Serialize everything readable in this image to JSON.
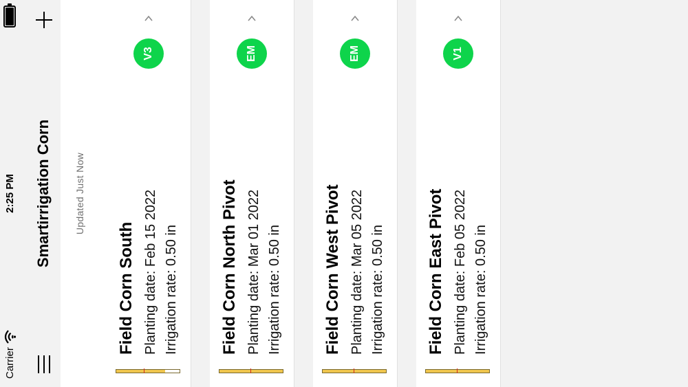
{
  "status_bar": {
    "carrier": "Carrier",
    "time": "2:25 PM"
  },
  "nav": {
    "title": "Smartirrigation Corn"
  },
  "updated_label": "Updated Just Now",
  "fields": [
    {
      "name": "Field Corn South",
      "planting": "Planting date: Feb 15 2022",
      "irrigation": "Irrigation rate: 0.50 in",
      "stage": "V3",
      "progress": 0.77,
      "marker": 0.55
    },
    {
      "name": "Field Corn North Pivot",
      "planting": "Planting date: Mar 01 2022",
      "irrigation": "Irrigation rate: 0.50 in",
      "stage": "EM",
      "progress": 1.0,
      "marker": 0.5
    },
    {
      "name": "Field Corn West Pivot",
      "planting": "Planting date: Mar 05 2022",
      "irrigation": "Irrigation rate: 0.50 in",
      "stage": "EM",
      "progress": 1.0,
      "marker": 0.5
    },
    {
      "name": "Field Corn East Pivot",
      "planting": "Planting date: Feb 05 2022",
      "irrigation": "Irrigation rate: 0.50 in",
      "stage": "V1",
      "progress": 1.0,
      "marker": 0.5
    }
  ],
  "colors": {
    "stage_badge": "#0ed44b",
    "progress_fill": "#f0c64e",
    "progress_marker": "#d12a1a"
  },
  "icons": {
    "menu": "hamburger-menu-icon",
    "add": "plus-icon",
    "collapse": "chevron-up-icon",
    "wifi": "wifi-icon",
    "battery": "battery-icon"
  }
}
